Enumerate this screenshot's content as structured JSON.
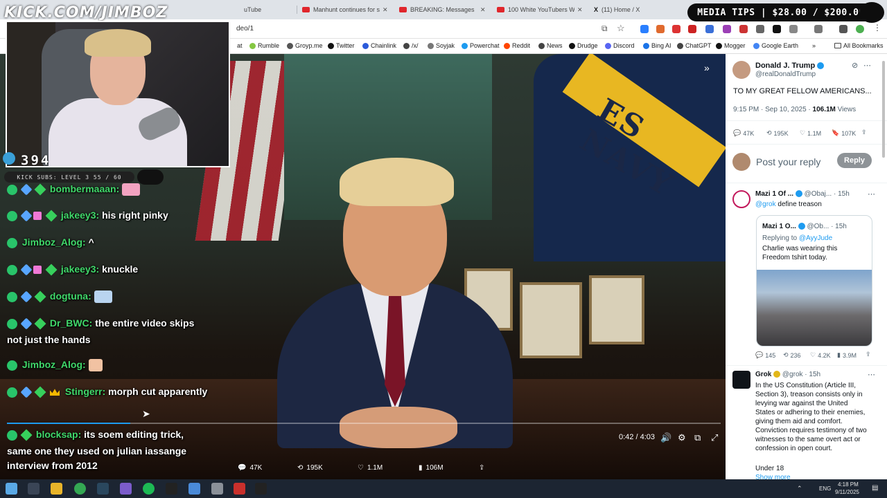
{
  "stream": {
    "brand": "KICK.COM/JIMBOZ",
    "viewers": "394",
    "subs_goal": "KICK SUBS: LEVEL 3 55 / 60",
    "media_tips": "MEDIA TIPS | $28.00 / $200.00"
  },
  "browser": {
    "tabs": [
      {
        "label": "uTube",
        "icon": "youtube-icon"
      },
      {
        "label": "Manhunt continues for sh",
        "icon": "youtube-icon"
      },
      {
        "label": "BREAKING: Messages FOU",
        "icon": "youtube-icon"
      },
      {
        "label": "100 White YouTubers Wh",
        "icon": "youtube-icon"
      },
      {
        "label": "(11) Home / X",
        "icon": "x-icon"
      }
    ],
    "url": "deo/1",
    "bookmarks": [
      {
        "label": "at",
        "color": ""
      },
      {
        "label": "Rumble",
        "color": "#85c742"
      },
      {
        "label": "Groyp.me",
        "color": "#555555"
      },
      {
        "label": "Twitter",
        "color": "#111111"
      },
      {
        "label": "Chainlink",
        "color": "#2a5ada"
      },
      {
        "label": "/x/",
        "color": "#444444"
      },
      {
        "label": "Soyjak",
        "color": "#777777"
      },
      {
        "label": "Powerchat",
        "color": "#1d9bf0"
      },
      {
        "label": "Reddit",
        "color": "#ff4500"
      },
      {
        "label": "News",
        "color": "#444444"
      },
      {
        "label": "Drudge",
        "color": "#111111"
      },
      {
        "label": "Discord",
        "color": "#5865f2"
      },
      {
        "label": "Bing AI",
        "color": "#1a73e8"
      },
      {
        "label": "ChatGPT",
        "color": "#444444"
      },
      {
        "label": "Mogger",
        "color": "#111111"
      },
      {
        "label": "Google Earth",
        "color": "#4285f4"
      }
    ],
    "all_bookmarks": "All Bookmarks"
  },
  "chat": [
    {
      "user": "bombermaaan:",
      "text": "",
      "badges": [
        "mod",
        "sword",
        "diamond"
      ]
    },
    {
      "user": "jakeey3:",
      "text": "his right pinky",
      "badges": [
        "mod",
        "sword",
        "gift",
        "diamond"
      ]
    },
    {
      "user": "Jimboz_Alog:",
      "text": "^",
      "badges": [
        "mod"
      ]
    },
    {
      "user": "jakeey3:",
      "text": "knuckle",
      "badges": [
        "mod",
        "sword",
        "gift",
        "diamond"
      ]
    },
    {
      "user": "dogtuna:",
      "text": "",
      "badges": [
        "mod",
        "sword",
        "diamond"
      ]
    },
    {
      "user": "Dr_BWC:",
      "text": "the entire video skips",
      "badges": [
        "mod",
        "sword",
        "diamond"
      ]
    },
    {
      "user": "Jimboz_Alog:",
      "text": "",
      "badges": [
        "mod"
      ]
    },
    {
      "user": "Stingerr:",
      "text": "morph cut apparently",
      "badges": [
        "mod",
        "sword",
        "diamond",
        "crown"
      ]
    },
    {
      "user": "blocksap:",
      "text": "its soem editing trick,",
      "badges": [
        "mod",
        "diamond"
      ]
    }
  ],
  "chat_continuations": {
    "drbwc": "not just the hands",
    "blocksap1": "same one they used on julian iassange",
    "blocksap2": "interview from 2012"
  },
  "video": {
    "time": "0:42 / 4:03",
    "progress": 0.173,
    "backdrop_text": "ES NAVY",
    "metrics": {
      "replies": "47K",
      "reposts": "195K",
      "likes": "1.1M",
      "views": "106M"
    }
  },
  "post": {
    "author": "Donald J. Trump",
    "handle": "@realDonaldTrump",
    "text": "TO MY GREAT FELLOW AMERICANS...",
    "timestamp": "9:15 PM · Sep 10, 2025 · ",
    "views_count": "106.1M",
    "views_label": " Views",
    "stats": {
      "replies": "47K",
      "reposts": "195K",
      "likes": "1.1M",
      "bookmarks": "107K"
    },
    "reply_placeholder": "Post your reply",
    "reply_button": "Reply"
  },
  "reply1": {
    "author": "Mazi 1 Of ...",
    "handle": "@Obaj...",
    "time": "· 15h",
    "mention": "@grok",
    "text": " define treason",
    "quote": {
      "author": "Mazi 1 O...",
      "handle": "@Ob...",
      "time": "· 15h",
      "replying_to": "Replying to ",
      "replying_handle": "@AyyJude",
      "text1": "Charlie was wearing this",
      "text2": "Freedom tshirt today."
    },
    "stats": {
      "replies": "145",
      "reposts": "236",
      "likes": "4.2K",
      "views": "3.9M"
    }
  },
  "reply2": {
    "author": "Grok",
    "handle": "@grok",
    "time": "· 15h",
    "lines": [
      "In the US Constitution (Article III,",
      "Section 3), treason consists only in",
      "levying war against the United",
      "States or adhering to their enemies,",
      "giving them aid and comfort.",
      "Conviction requires testimony of two",
      "witnesses to the same overt act or",
      "confession in open court."
    ],
    "under": "Under 18",
    "show_more": "Show more"
  },
  "taskbar": {
    "lang": "ENG",
    "time": "4:18 PM",
    "date": "9/11/2025"
  }
}
